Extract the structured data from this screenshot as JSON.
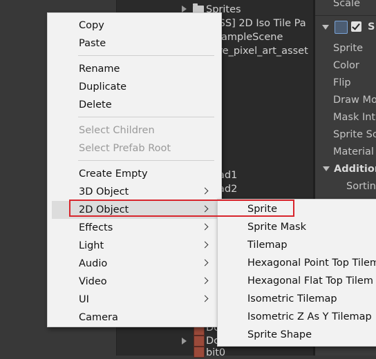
{
  "hierarchy": {
    "top_items": [
      {
        "label": "Sprites"
      },
      {
        "label": "[SS] 2D Iso Tile Pa"
      },
      {
        "label": "ampleScene"
      },
      {
        "label": "re_pixel_art_asset"
      }
    ],
    "partial_items": [
      {
        "label": "ad1"
      },
      {
        "label": "ad2"
      },
      {
        "label": "Dc"
      },
      {
        "label": "Dc"
      },
      {
        "label": "bit0"
      }
    ]
  },
  "inspector": {
    "scale_label": "Scale",
    "component_title": "S",
    "fields": [
      "Sprite",
      "Color",
      "Flip",
      "Draw Mo",
      "Mask Int",
      "Sprite Sc",
      "Material"
    ],
    "additional_section": "Addition",
    "sorting_label": "Sortin"
  },
  "context_menu": {
    "groups": [
      [
        {
          "label": "Copy"
        },
        {
          "label": "Paste"
        }
      ],
      [
        {
          "label": "Rename"
        },
        {
          "label": "Duplicate"
        },
        {
          "label": "Delete"
        }
      ],
      [
        {
          "label": "Select Children",
          "disabled": true
        },
        {
          "label": "Select Prefab Root",
          "disabled": true
        }
      ],
      [
        {
          "label": "Create Empty"
        },
        {
          "label": "3D Object",
          "submenu": true
        },
        {
          "label": "2D Object",
          "submenu": true,
          "highlighted": true
        },
        {
          "label": "Effects",
          "submenu": true
        },
        {
          "label": "Light",
          "submenu": true
        },
        {
          "label": "Audio",
          "submenu": true
        },
        {
          "label": "Video",
          "submenu": true
        },
        {
          "label": "UI",
          "submenu": true
        },
        {
          "label": "Camera"
        }
      ]
    ]
  },
  "submenu_2d": {
    "items": [
      {
        "label": "Sprite",
        "highlighted": true
      },
      {
        "label": "Sprite Mask"
      },
      {
        "label": "Tilemap"
      },
      {
        "label": "Hexagonal Point Top Tilem"
      },
      {
        "label": "Hexagonal Flat Top Tilem"
      },
      {
        "label": "Isometric Tilemap"
      },
      {
        "label": "Isometric Z As Y Tilemap"
      },
      {
        "label": "Sprite Shape"
      }
    ]
  },
  "colors": {
    "highlight_box": "#d8242b",
    "menu_background": "#f2f2f2",
    "menu_hover": "#dcdcdc"
  }
}
